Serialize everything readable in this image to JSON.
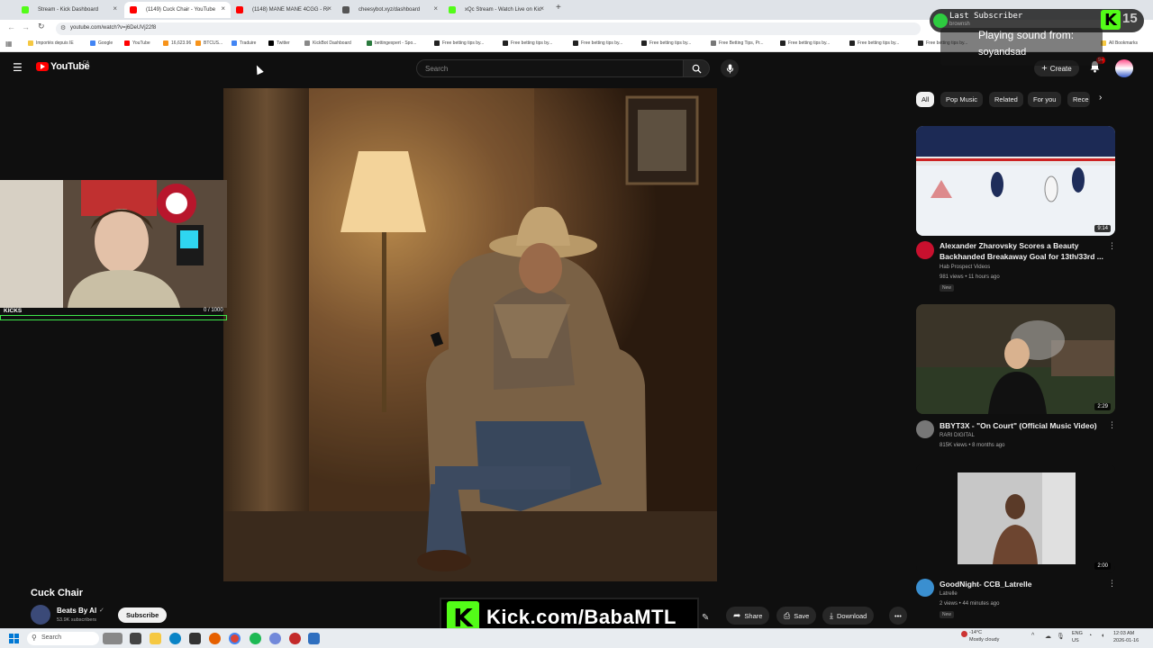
{
  "browser": {
    "tabs": [
      {
        "title": "Stream - Kick Dashboard",
        "favicon_color": "#53fc18",
        "active": false
      },
      {
        "title": "(1149) Cuck Chair - YouTube",
        "favicon_color": "#ff0000",
        "active": true
      },
      {
        "title": "(1148) MANE MANE 4CGG - Ri",
        "favicon_color": "#ff0000",
        "active": false
      },
      {
        "title": "cheesybot.xyz/dashboard",
        "favicon_color": "#555555",
        "active": false
      },
      {
        "title": "xQc Stream - Watch Live on Kic",
        "favicon_color": "#53fc18",
        "active": false
      }
    ],
    "new_tab": "+",
    "url": "youtube.com/watch?v=j6DeUVj22f8",
    "bookmarks": [
      "Importés depuis IE",
      "Google",
      "YouTube",
      "16,623.96",
      "BTCUS...",
      "Traduire",
      "Twitter",
      "KickBot Dashboard",
      "bettingexpert - Spo...",
      "Free betting tips by...",
      "Free betting tips by...",
      "Free betting tips by...",
      "Free betting tips by...",
      "Free Betting Tips, Pr...",
      "Free betting tips by...",
      "Free betting tips by...",
      "Free betting tips by...",
      "All Bookmarks"
    ]
  },
  "youtube": {
    "logo_text": "YouTube",
    "country": "CA",
    "search_placeholder": "Search",
    "create_label": "Create",
    "notif_count": "9+",
    "chips": [
      "All",
      "Pop Music",
      "Related",
      "For you",
      "Rece"
    ],
    "video": {
      "title": "Cuck Chair",
      "channel": "Beats By AI",
      "subscribers": "53.9K subscribers",
      "subscribe_label": "Subscribe",
      "share_label": "Share",
      "save_label": "Save",
      "download_label": "Download"
    },
    "recommended": [
      {
        "title": "Alexander Zharovsky Scores a Beauty Backhanded Breakaway Goal for 13th/33rd ...",
        "channel": "Hab Prospect Videos",
        "meta": "981 views • 11 hours ago",
        "badge": "New",
        "duration": "9:14"
      },
      {
        "title": "BBYT3X - \"On Court\" (Official Music Video)",
        "channel": "RARI DIGITAL",
        "meta": "815K views • 8 months ago",
        "badge": "",
        "duration": "2:29"
      },
      {
        "title": "GoodNight- CCB_Latrelle",
        "channel": "Latrelle",
        "meta": "2 views • 44 minutes ago",
        "badge": "New",
        "duration": "2:00"
      }
    ]
  },
  "stream_overlay": {
    "webcam_label": "KICKS",
    "kicks_progress": "0 / 1000",
    "kick_banner": "Kick.com/BabaMTL",
    "alert_title": "Last Subscriber",
    "alert_sub": "brownsh",
    "alert_playing": "Playing sound from:",
    "alert_user": "soyandsad",
    "alert_count": "15"
  },
  "taskbar": {
    "search_placeholder": "Search",
    "weather": "-14°C",
    "weather_desc": "Mostly cloudy",
    "lang": "ENG",
    "region": "US",
    "time": "12:03 AM",
    "date": "2026-01-16"
  }
}
